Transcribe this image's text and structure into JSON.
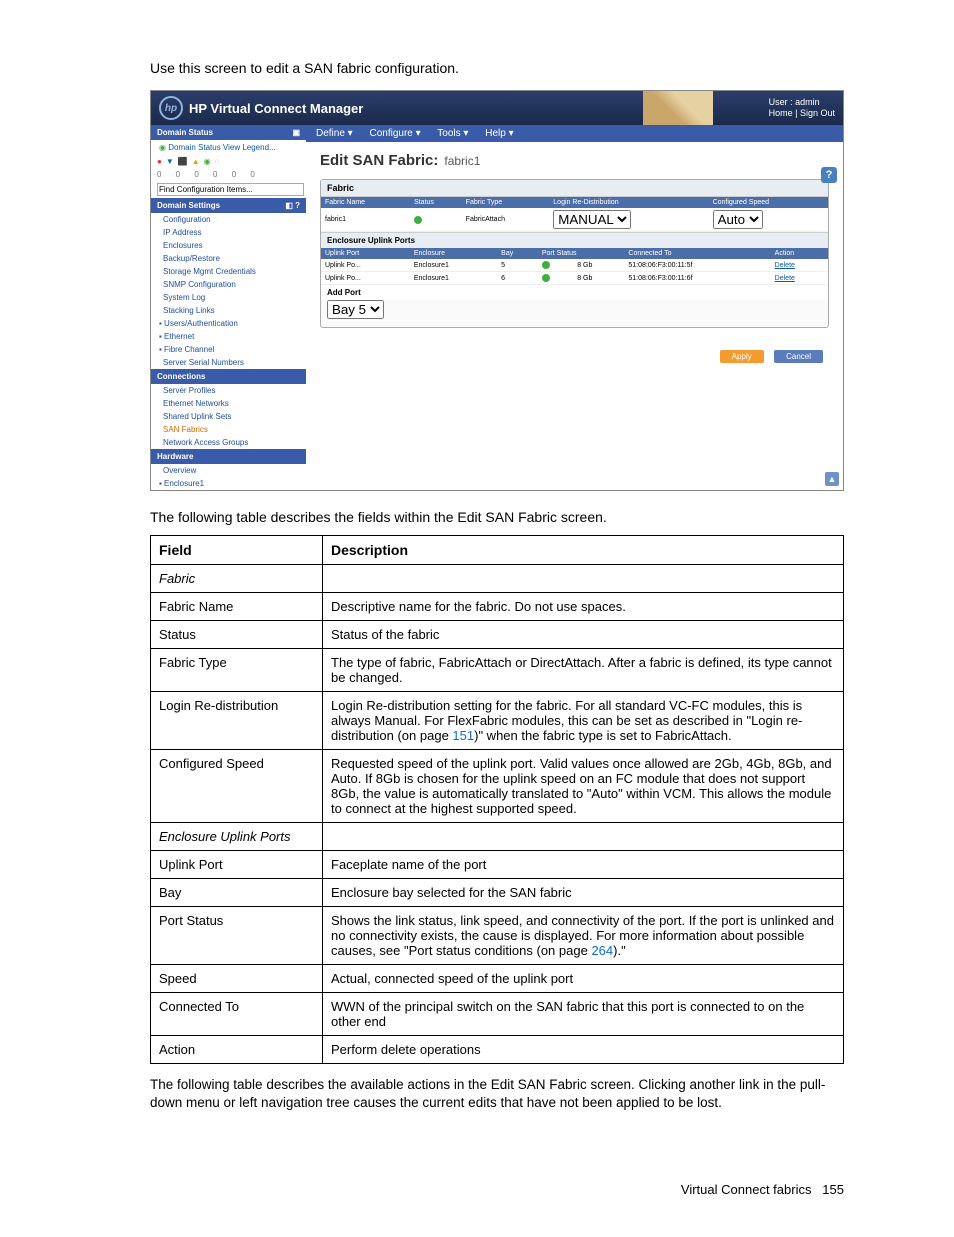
{
  "intro": "Use this screen to edit a SAN fabric configuration.",
  "header": {
    "app": "HP Virtual Connect Manager",
    "user_line1": "User : admin",
    "user_line2": "Home  |  Sign Out"
  },
  "menu": {
    "define": "Define ▾",
    "configure": "Configure ▾",
    "tools": "Tools ▾",
    "help": "Help ▾"
  },
  "nav": {
    "domain_status": "Domain Status",
    "view_legend": "Domain Status   View Legend...",
    "find": "Find Configuration Items...",
    "settings": "Domain Settings",
    "items1": [
      "Configuration",
      "IP Address",
      "Enclosures",
      "Backup/Restore",
      "Storage Mgmt Credentials",
      "SNMP Configuration",
      "System Log",
      "Stacking Links"
    ],
    "cats1": [
      "Users/Authentication",
      "Ethernet",
      "Fibre Channel"
    ],
    "items2": [
      "Server Serial Numbers"
    ],
    "connections": "Connections",
    "items3": [
      "Server Profiles",
      "Ethernet Networks",
      "Shared Uplink Sets"
    ],
    "san_fabrics": "SAN Fabrics",
    "items4": [
      "Network Access Groups"
    ],
    "hardware": "Hardware",
    "items5": [
      "Overview"
    ],
    "cats2": [
      "Enclosure1"
    ]
  },
  "main": {
    "title": "Edit SAN Fabric:",
    "subtitle": "fabric1",
    "help": "?",
    "fabric_hdr": "Fabric",
    "cols": {
      "name": "Fabric Name",
      "status": "Status",
      "type": "Fabric Type",
      "login": "Login Re-Distribution",
      "speed": "Configured Speed"
    },
    "row": {
      "name": "fabric1",
      "type": "FabricAttach",
      "login": "MANUAL",
      "speed": "Auto"
    },
    "uplink_hdr": "Enclosure Uplink Ports",
    "ucols": {
      "port": "Uplink Port",
      "enc": "Enclosure",
      "bay": "Bay",
      "pstat": "Port Status",
      "conn": "Connected To",
      "act": "Action"
    },
    "urows": [
      {
        "port": "Uplink Po...",
        "enc": "Enclosure1",
        "bay": "5",
        "speed": "8 Gb",
        "conn": "51:08:06:F3:00:11:5f",
        "act": "Delete"
      },
      {
        "port": "Uplink Po...",
        "enc": "Enclosure1",
        "bay": "6",
        "speed": "8 Gb",
        "conn": "51:08:06:F3:00:11:6f",
        "act": "Delete"
      }
    ],
    "add_label": "Add Port",
    "add_value": "Bay 5",
    "apply": "Apply",
    "cancel": "Cancel"
  },
  "table_intro": "The following table describes the fields within the Edit SAN Fabric screen.",
  "table": {
    "h1": "Field",
    "h2": "Description",
    "rows": [
      {
        "f": "Fabric",
        "d": "",
        "section": true
      },
      {
        "f": "Fabric Name",
        "d": "Descriptive name for the fabric. Do not use spaces."
      },
      {
        "f": "Status",
        "d": "Status of the fabric"
      },
      {
        "f": "Fabric Type",
        "d": "The type of fabric, FabricAttach or DirectAttach. After a fabric is defined, its type cannot be changed."
      },
      {
        "f": "Login Re-distribution",
        "d": "Login Re-distribution setting for the fabric. For all standard VC-FC modules, this is always Manual. For FlexFabric modules, this can be set as described in \"Login re-distribution (on page 151)\" when the fabric type is set to FabricAttach.",
        "link_text": "151"
      },
      {
        "f": "Configured Speed",
        "d": "Requested speed of the uplink port. Valid values once allowed are 2Gb, 4Gb, 8Gb, and Auto. If 8Gb is chosen for the uplink speed on an FC module that does not support 8Gb, the value is automatically translated to \"Auto\" within VCM. This allows the module to connect at the highest supported speed."
      },
      {
        "f": "Enclosure Uplink Ports",
        "d": "",
        "section": true
      },
      {
        "f": "Uplink Port",
        "d": "Faceplate name of the port"
      },
      {
        "f": "Bay",
        "d": "Enclosure bay selected for the SAN fabric"
      },
      {
        "f": "Port Status",
        "d": "Shows the link status, link speed, and connectivity of the port. If the port is unlinked and no connectivity exists, the cause is displayed. For more information about possible causes, see \"Port status conditions (on page 264).\"",
        "link_text": "264"
      },
      {
        "f": "Speed",
        "d": "Actual, connected speed of the uplink port"
      },
      {
        "f": "Connected To",
        "d": "WWN of the principal switch on the SAN fabric that this port is connected to on the other end"
      },
      {
        "f": "Action",
        "d": "Perform delete operations"
      }
    ]
  },
  "bottom_note": "The following table describes the available actions in the Edit SAN Fabric screen. Clicking another link in the pull-down menu or left navigation tree causes the current edits that have not been applied to be lost.",
  "footer": {
    "section": "Virtual Connect fabrics",
    "page": "155"
  }
}
